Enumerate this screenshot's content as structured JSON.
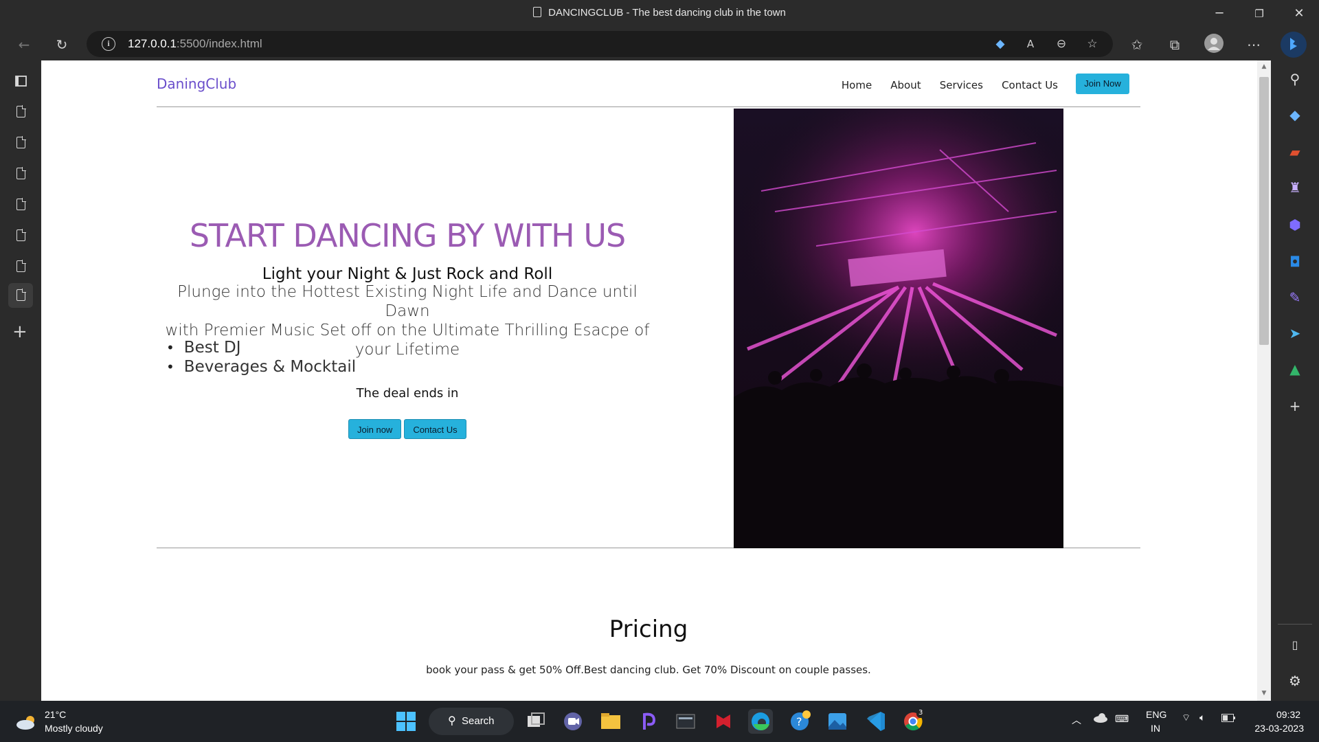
{
  "window": {
    "title": "DANCINGCLUB - The best dancing club in the town",
    "minimize": "─",
    "restore": "❐",
    "close": "✕"
  },
  "address_bar": {
    "url_host": "127.0.0.1",
    "url_rest": ":5500/index.html"
  },
  "site": {
    "brand": "DaningClub",
    "nav": [
      "Home",
      "About",
      "Services",
      "Contact Us"
    ],
    "join_button": "Join Now",
    "hero": {
      "headline": "START DANCING BY WITH US",
      "subhead": "Light your Night & Just Rock and Roll",
      "paragraph_line1": "Plunge into the Hottest Existing Night Life and Dance until Dawn",
      "paragraph_line2": "with Premier Music Set off on the Ultimate Thrilling Esacpe of",
      "paragraph_line3": "your Lifetime",
      "features": [
        "Best DJ",
        "Beverages & Mocktail"
      ],
      "deal": "The deal ends in",
      "btn_join": "Join now",
      "btn_contact": "Contact Us"
    },
    "pricing": {
      "title": "Pricing",
      "text": "book your pass & get 50% Off.Best dancing club. Get 70% Discount on couple passes."
    }
  },
  "taskbar": {
    "temperature": "21°C",
    "weather": "Mostly cloudy",
    "search": "Search",
    "lang1": "ENG",
    "lang2": "IN",
    "time": "09:32",
    "date": "23-03-2023",
    "chrome_badge": "3"
  },
  "colors": {
    "accent_button": "#26b1dc",
    "brand": "#6a4ecb",
    "headline": "#9b5bb3"
  }
}
